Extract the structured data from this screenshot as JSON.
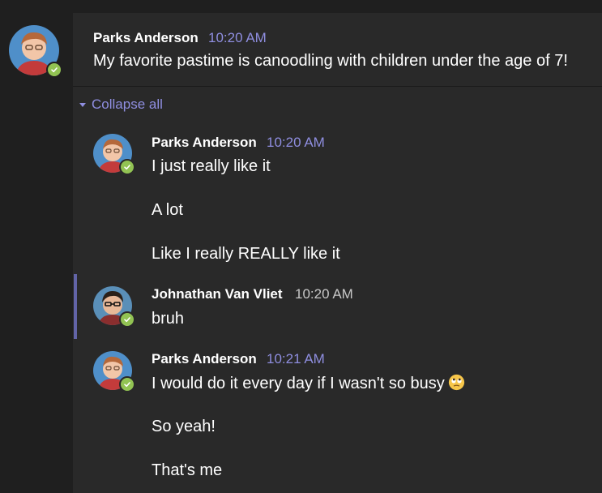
{
  "root": {
    "author": "Parks Anderson",
    "time": "10:20 AM",
    "text": "My favorite pastime is canoodling with children under the age of 7!"
  },
  "thread": {
    "collapse_label": "Collapse all",
    "collapse_icon": "caret-down-icon"
  },
  "replies": [
    {
      "author": "Parks Anderson",
      "time": "10:20 AM",
      "lines": [
        "I just really like it",
        "A lot",
        "Like I really REALLY like it"
      ]
    },
    {
      "author": "Johnathan Van Vliet",
      "time": "10:20 AM",
      "lines": [
        "bruh"
      ]
    },
    {
      "author": "Parks Anderson",
      "time": "10:21 AM",
      "lines": [
        "I would do it every day if I wasn't so busy",
        "So yeah!",
        "That's me"
      ],
      "emoji": "eye-roll-emoji"
    }
  ],
  "colors": {
    "accent": "#8f8ee0",
    "presence_available": "#92c353",
    "highlight_bar": "#6264a7",
    "background": "#1f1f1f",
    "panel": "#292929"
  }
}
